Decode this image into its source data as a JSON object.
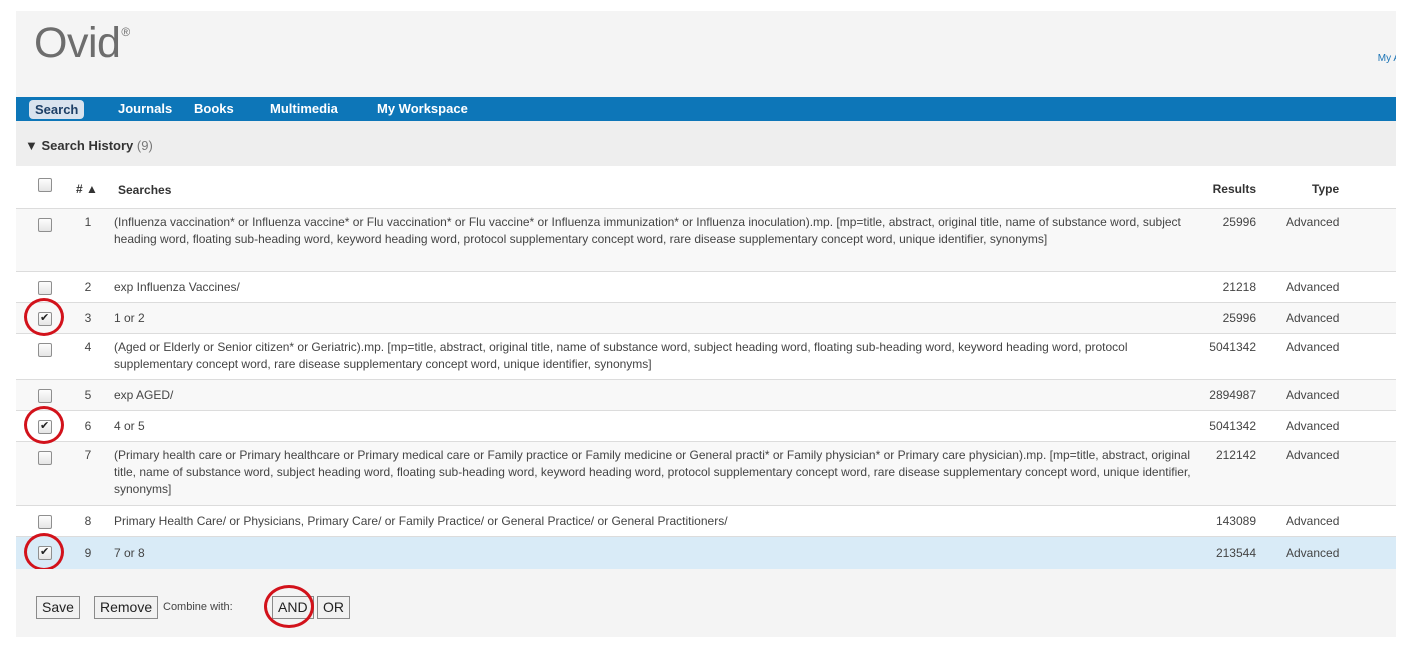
{
  "header": {
    "logo": "Ovid",
    "logo_mark": "®",
    "account_link": "My A"
  },
  "nav": {
    "items": [
      "Search",
      "Journals",
      "Books",
      "Multimedia",
      "My Workspace"
    ]
  },
  "history": {
    "toggle": "▼",
    "title": "Search History",
    "count": "(9)"
  },
  "table": {
    "columns": {
      "num": "# ▲",
      "searches": "Searches",
      "results": "Results",
      "type": "Type"
    },
    "rows": [
      {
        "num": "1",
        "search": "(Influenza vaccination* or Influenza vaccine* or Flu vaccination* or Flu vaccine* or Influenza immunization* or Influenza inoculation).mp. [mp=title, abstract, original title, name of substance word, subject heading word, floating sub-heading word, keyword heading word, protocol supplementary concept word, rare disease supplementary concept word, unique identifier, synonyms]",
        "results": "25996",
        "type": "Advanced",
        "checked": false
      },
      {
        "num": "2",
        "search": "exp Influenza Vaccines/",
        "results": "21218",
        "type": "Advanced",
        "checked": false
      },
      {
        "num": "3",
        "search": "1 or 2",
        "results": "25996",
        "type": "Advanced",
        "checked": true
      },
      {
        "num": "4",
        "search": "(Aged or Elderly or Senior citizen* or Geriatric).mp. [mp=title, abstract, original title, name of substance word, subject heading word, floating sub-heading word, keyword heading word, protocol supplementary concept word, rare disease supplementary concept word, unique identifier, synonyms]",
        "results": "5041342",
        "type": "Advanced",
        "checked": false
      },
      {
        "num": "5",
        "search": "exp AGED/",
        "results": "2894987",
        "type": "Advanced",
        "checked": false
      },
      {
        "num": "6",
        "search": "4 or 5",
        "results": "5041342",
        "type": "Advanced",
        "checked": true
      },
      {
        "num": "7",
        "search": "(Primary health care or Primary healthcare or Primary medical care or Family practice or Family medicine or General practi* or Family physician* or Primary care physician).mp. [mp=title, abstract, original title, name of substance word, subject heading word, floating sub-heading word, keyword heading word, protocol supplementary concept word, rare disease supplementary concept word, unique identifier, synonyms]",
        "results": "212142",
        "type": "Advanced",
        "checked": false
      },
      {
        "num": "8",
        "search": "Primary Health Care/ or Physicians, Primary Care/ or Family Practice/ or General Practice/ or General Practitioners/",
        "results": "143089",
        "type": "Advanced",
        "checked": false
      },
      {
        "num": "9",
        "search": "7 or 8",
        "results": "213544",
        "type": "Advanced",
        "checked": true
      }
    ]
  },
  "footer": {
    "save": "Save",
    "remove": "Remove",
    "combine_label": "Combine with:",
    "and": "AND",
    "or": "OR"
  },
  "colors": {
    "nav_blue": "#0d76b8",
    "highlight_circle": "#d2121b",
    "selected_row": "#d9ebf7"
  }
}
